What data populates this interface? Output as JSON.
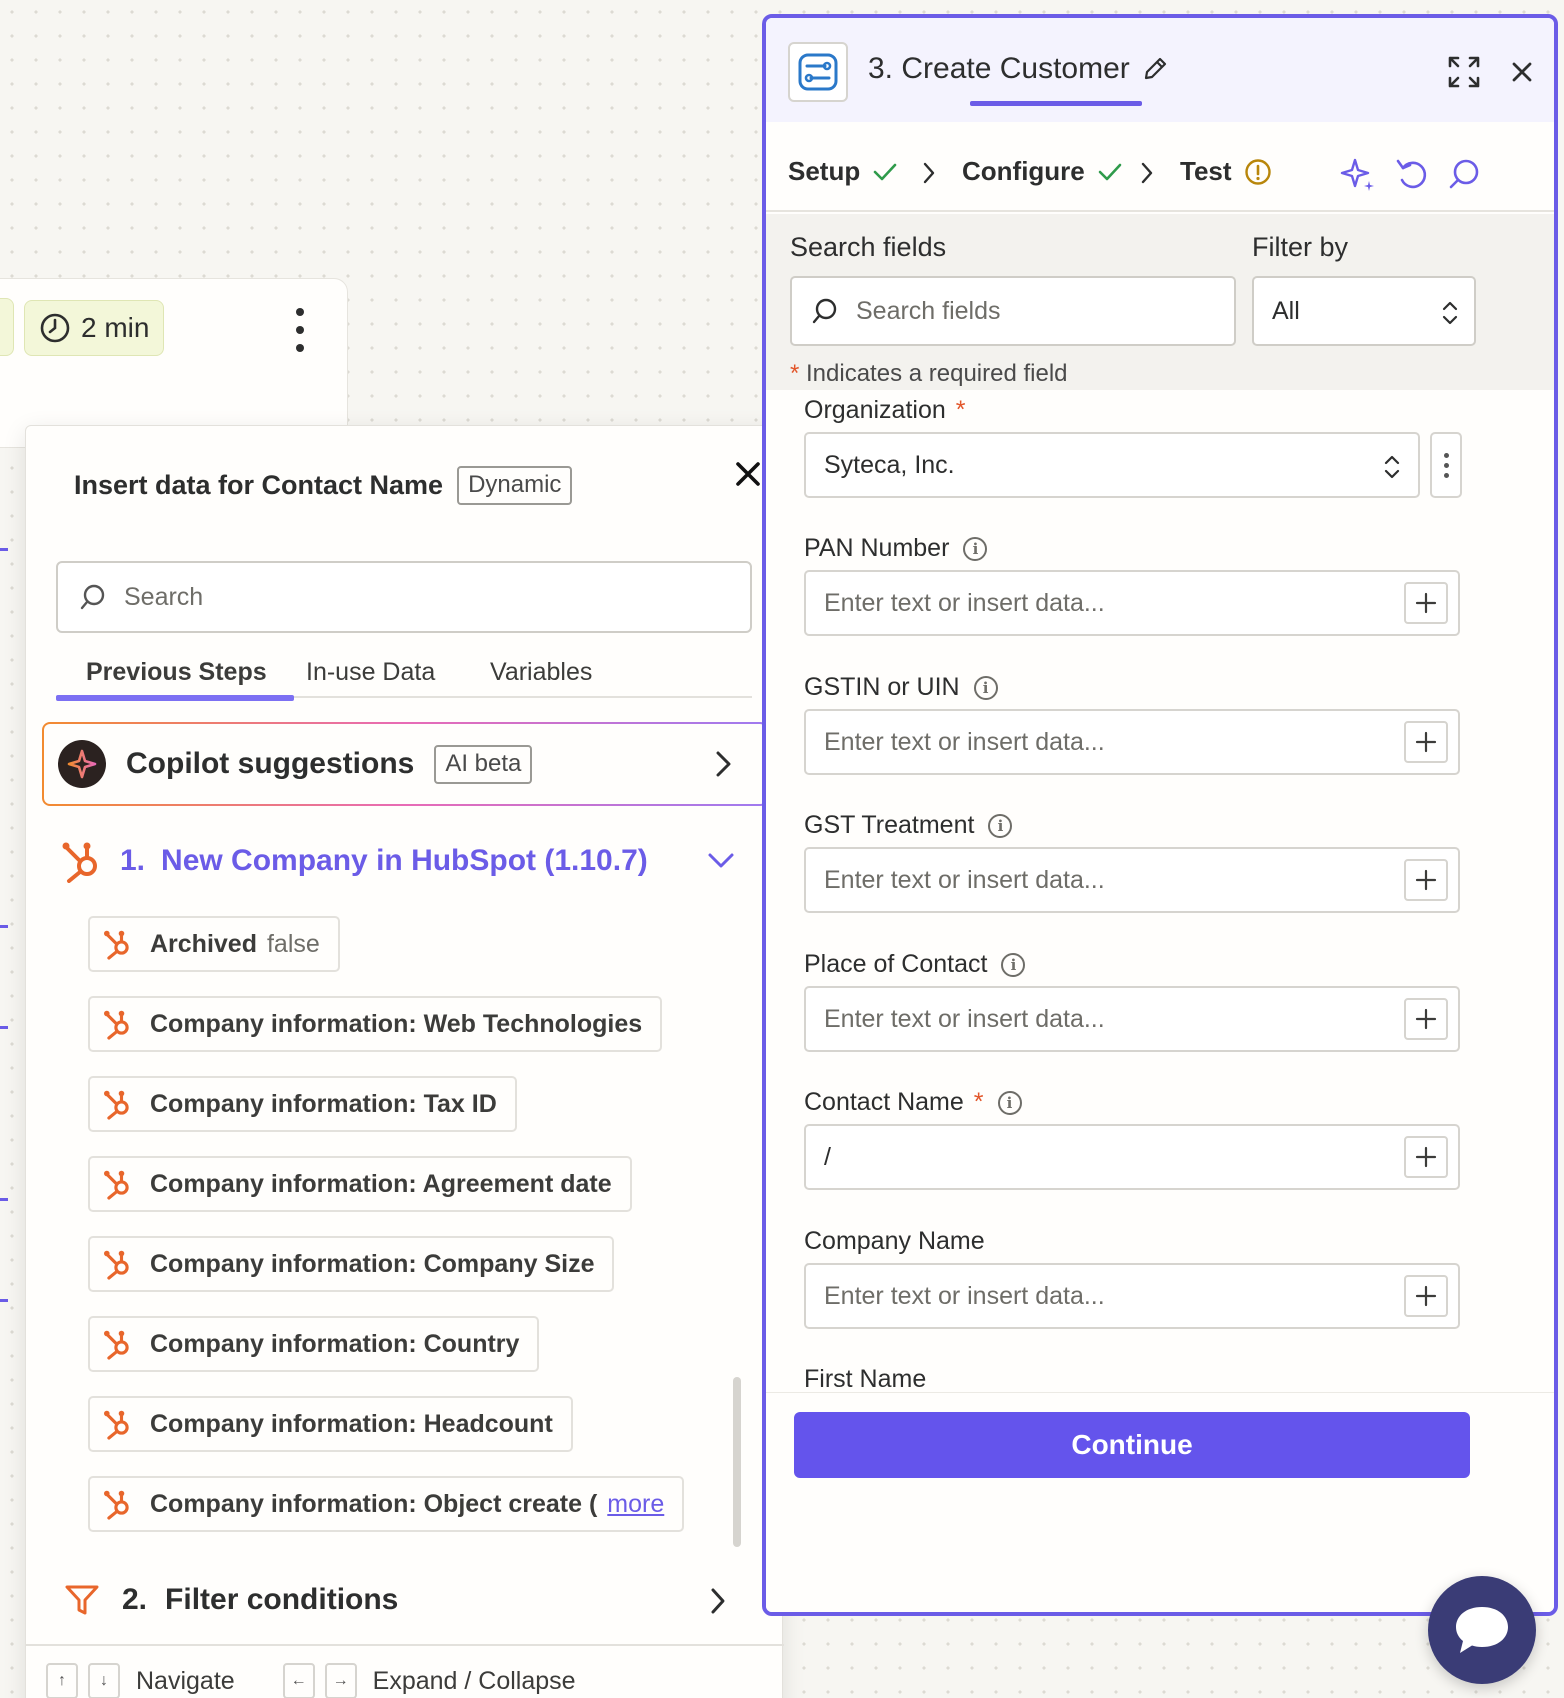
{
  "canvas": {
    "duration_badge": "2 min"
  },
  "popover": {
    "title": "Insert data for Contact Name",
    "title_tag": "Dynamic",
    "search_placeholder": "Search",
    "tabs": [
      "Previous Steps",
      "In-use Data",
      "Variables"
    ],
    "active_tab": "Previous Steps",
    "copilot": {
      "title": "Copilot suggestions",
      "tag": "AI beta"
    },
    "step1": {
      "number": "1.",
      "title": "New Company in HubSpot (1.10.7)",
      "items": [
        {
          "label": "Archived",
          "value": "false"
        },
        {
          "label": "Company information: Web Technologies"
        },
        {
          "label": "Company information: Tax ID"
        },
        {
          "label": "Company information: Agreement date"
        },
        {
          "label": "Company information: Company Size"
        },
        {
          "label": "Company information: Country"
        },
        {
          "label": "Company information: Headcount"
        },
        {
          "label": "Company information: Object create (",
          "more": "more"
        }
      ]
    },
    "step2": {
      "number": "2.",
      "title": "Filter conditions"
    },
    "footer": {
      "navigate": "Navigate",
      "expand_collapse": "Expand / Collapse"
    }
  },
  "panel": {
    "title": "3. Create Customer",
    "wizard": [
      "Setup",
      "Configure",
      "Test"
    ],
    "active_step": "Configure",
    "search_label": "Search fields",
    "search_placeholder": "Search fields",
    "filter_label": "Filter by",
    "filter_value": "All",
    "required_note": "Indicates a required field",
    "required_star": "*",
    "fields": [
      {
        "label": "Organization",
        "required": true,
        "value": "Syteca, Inc."
      },
      {
        "label": "PAN Number",
        "placeholder": "Enter text or insert data..."
      },
      {
        "label": "GSTIN or UIN",
        "placeholder": "Enter text or insert data..."
      },
      {
        "label": "GST Treatment",
        "placeholder": "Enter text or insert data..."
      },
      {
        "label": "Place of Contact",
        "placeholder": "Enter text or insert data..."
      },
      {
        "label": "Contact Name",
        "required": true,
        "value": "/"
      },
      {
        "label": "Company Name",
        "placeholder": "Enter text or insert data..."
      },
      {
        "label": "First Name"
      }
    ],
    "continue_label": "Continue"
  },
  "colors": {
    "accent": "#6b5ce7",
    "continue": "#6454ec",
    "hubspot": "#e8662b",
    "required": "#e2562a",
    "success": "#2f9b4b",
    "warning": "#b8860b",
    "chat_fab": "#3a3c76"
  },
  "icons": [
    "clock-icon",
    "more-vertical-icon",
    "close-icon",
    "search-icon",
    "copilot-sparkle-icon",
    "chevron-right-icon",
    "chevron-down-icon",
    "hubspot-icon",
    "filter-icon",
    "arrow-up-icon",
    "arrow-down-icon",
    "arrow-left-icon",
    "arrow-right-icon",
    "app-icon",
    "pencil-icon",
    "expand-icon",
    "check-icon",
    "warning-icon",
    "ai-sparkle-icon",
    "undo-icon",
    "comment-icon",
    "updown-icon",
    "info-icon",
    "plus-icon",
    "chat-icon"
  ]
}
